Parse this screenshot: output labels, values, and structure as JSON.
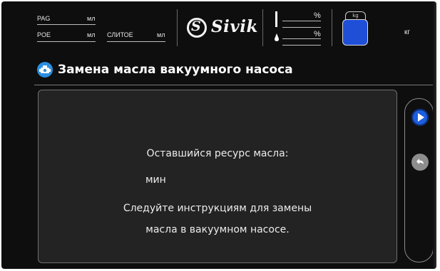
{
  "header": {
    "fields": {
      "pag": {
        "label": "PAG",
        "unit": "мл"
      },
      "poe": {
        "label": "POE",
        "unit": "мл"
      },
      "drain": {
        "label": "СЛИТОЕ",
        "unit": "мл"
      }
    },
    "logo_text": "Sivik",
    "gauge_top_unit": "%",
    "gauge_bottom_unit": "%",
    "tank_label": "kg",
    "tank_unit": "кг",
    "icons": {
      "logo": "sivik-logo-icon",
      "level": "level-bar-icon",
      "drop": "oil-drop-icon",
      "tank": "refrigerant-tank-icon"
    },
    "colors": {
      "tank_fill": "#1f4fd6"
    }
  },
  "title": {
    "icon": "vacuum-pump-icon",
    "text": "Замена масла вакуумного насоса",
    "icon_color": "#2a8fe0"
  },
  "panel": {
    "line1": "Оставшийся ресурс масла:",
    "line2": "мин",
    "line3": "Следуйте инструкциям для замены",
    "line4": "масла в вакуумном насосе."
  },
  "buttons": {
    "next_icon": "play-next-icon",
    "back_icon": "back-arrow-icon",
    "next_color": "#1d5fe0",
    "back_color": "#8d8d8d"
  }
}
